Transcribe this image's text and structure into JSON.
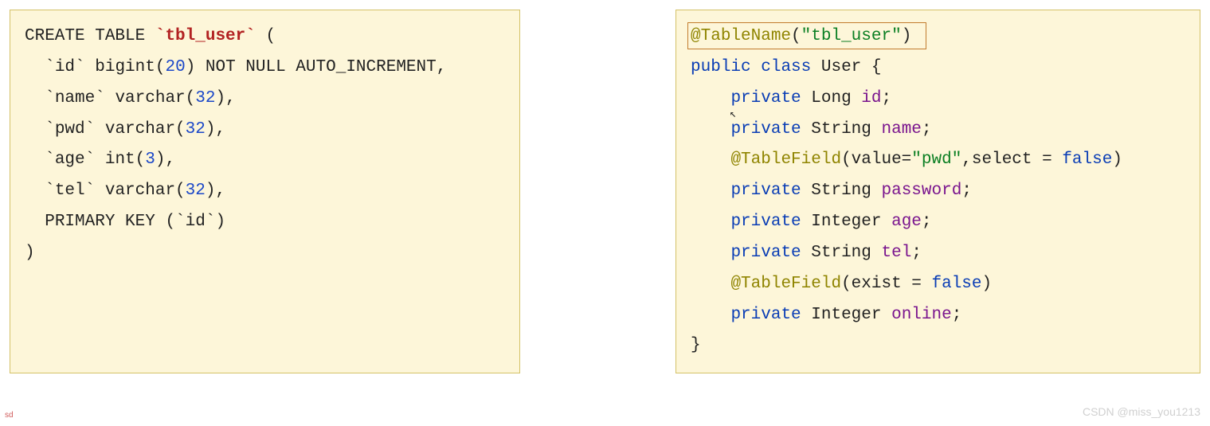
{
  "sql": {
    "create": "CREATE TABLE",
    "table_name": "`tbl_user`",
    "open": " (",
    "col_id_name": "`id`",
    "col_id_type": " bigint(",
    "col_id_n": "20",
    "col_id_rest": ") NOT NULL AUTO_INCREMENT,",
    "col_name_name": "`name`",
    "col_name_type": " varchar(",
    "col_name_n": "32",
    "col_name_rest": "),",
    "col_pwd_name": "`pwd`",
    "col_pwd_type": " varchar(",
    "col_pwd_n": "32",
    "col_pwd_rest": "),",
    "col_age_name": "`age`",
    "col_age_type": " int(",
    "col_age_n": "3",
    "col_age_rest": "),",
    "col_tel_name": "`tel`",
    "col_tel_type": " varchar(",
    "col_tel_n": "32",
    "col_tel_rest": "),",
    "pk": "PRIMARY KEY (`id`)",
    "close": ")"
  },
  "java": {
    "ann1_name": "@TableName",
    "ann1_open": "(",
    "ann1_str": "\"tbl_user\"",
    "ann1_close": ")",
    "public": "public",
    "class_kw": "class",
    "class_name": "User",
    "open_brace": " {",
    "private": "private",
    "type_long": "Long",
    "fld_id": "id",
    "type_string": "String",
    "fld_name": "name",
    "ann2_name": "@TableField",
    "ann2_open": "(value=",
    "ann2_str": "\"pwd\"",
    "ann2_mid": ",select = ",
    "ann2_false": "false",
    "ann2_close": ")",
    "fld_password": "password",
    "type_integer": "Integer",
    "fld_age": "age",
    "fld_tel": "tel",
    "ann3_name": "@TableField",
    "ann3_open": "(exist = ",
    "ann3_false": "false",
    "ann3_close": ")",
    "fld_online": "online",
    "close_brace": "}",
    "semi": ";"
  },
  "meta": {
    "watermark": "CSDN @miss_you1213",
    "sd": "sd"
  }
}
